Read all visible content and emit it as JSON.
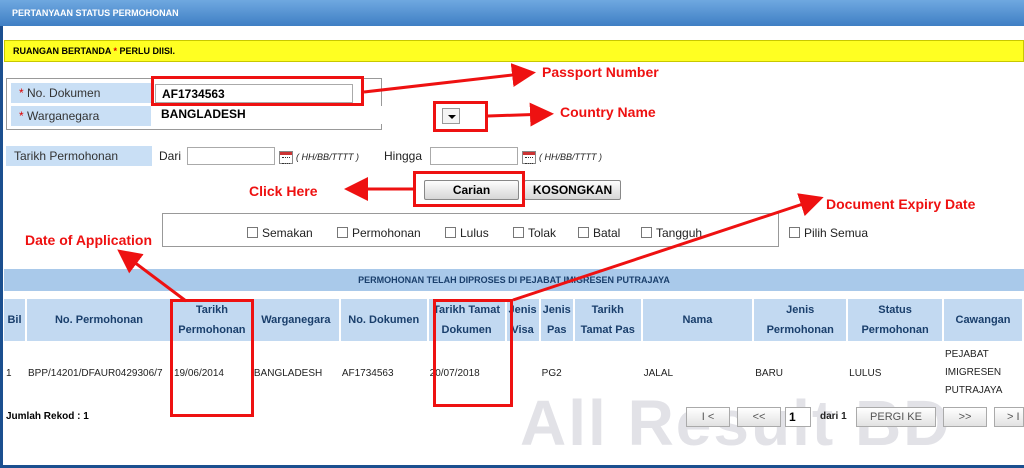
{
  "title_bar": "PERTANYAAN STATUS PERMOHONAN",
  "required_note": {
    "prefix": "RUANGAN BERTANDA ",
    "star": "*",
    "suffix": " PERLU DIISI."
  },
  "form": {
    "doc_label": "No. Dokumen",
    "doc_value": "AF1734563",
    "country_label": "Warganegara",
    "country_value": "BANGLADESH",
    "date_label": "Tarikh Permohonan",
    "from_label": "Dari",
    "to_label": "Hingga",
    "date_format": "( HH/BB/TTTT )",
    "search_button": "Carian",
    "clear_button": "KOSONGKAN"
  },
  "status_filters": [
    "Semakan",
    "Permohonan",
    "Lulus",
    "Tolak",
    "Batal",
    "Tangguh"
  ],
  "select_all": "Pilih Semua",
  "section_title": "PERMOHONAN TELAH DIPROSES DI PEJABAT IMIGRESEN PUTRAJAYA",
  "table": {
    "headers": [
      "Bil",
      "No. Permohonan",
      "Tarikh Permohonan",
      "Warganegara",
      "No. Dokumen",
      "Tarikh Tamat Dokumen",
      "Jenis Visa",
      "Jenis Pas",
      "Tarikh Tamat Pas",
      "Nama",
      "Jenis Permohonan",
      "Status Permohonan",
      "Cawangan"
    ],
    "rows": [
      [
        "1",
        "BPP/14201/DFAUR0429306/7",
        "19/06/2014",
        "BANGLADESH",
        "AF1734563",
        "20/07/2018",
        "",
        "PG2",
        "",
        "JALAL",
        "BARU",
        "LULUS",
        "PEJABAT IMIGRESEN PUTRAJAYA"
      ]
    ]
  },
  "footer": {
    "record_count": "Jumlah Rekod : 1",
    "first": "I <",
    "prev": "<<",
    "page": "1",
    "of_pages": "dari 1",
    "goto": "PERGI KE",
    "next": ">>",
    "last": "> I"
  },
  "watermark": "All Result BD",
  "annotations": {
    "passport": "Passport Number",
    "country": "Country Name",
    "click": "Click Here",
    "expiry": "Document Expiry Date",
    "application": "Date of Application"
  },
  "colors": {
    "accent_red": "#e11111",
    "required_yellow": "#ffff22",
    "header_blue": "#c2d9f1",
    "title_blue": "#3f7fc4"
  }
}
